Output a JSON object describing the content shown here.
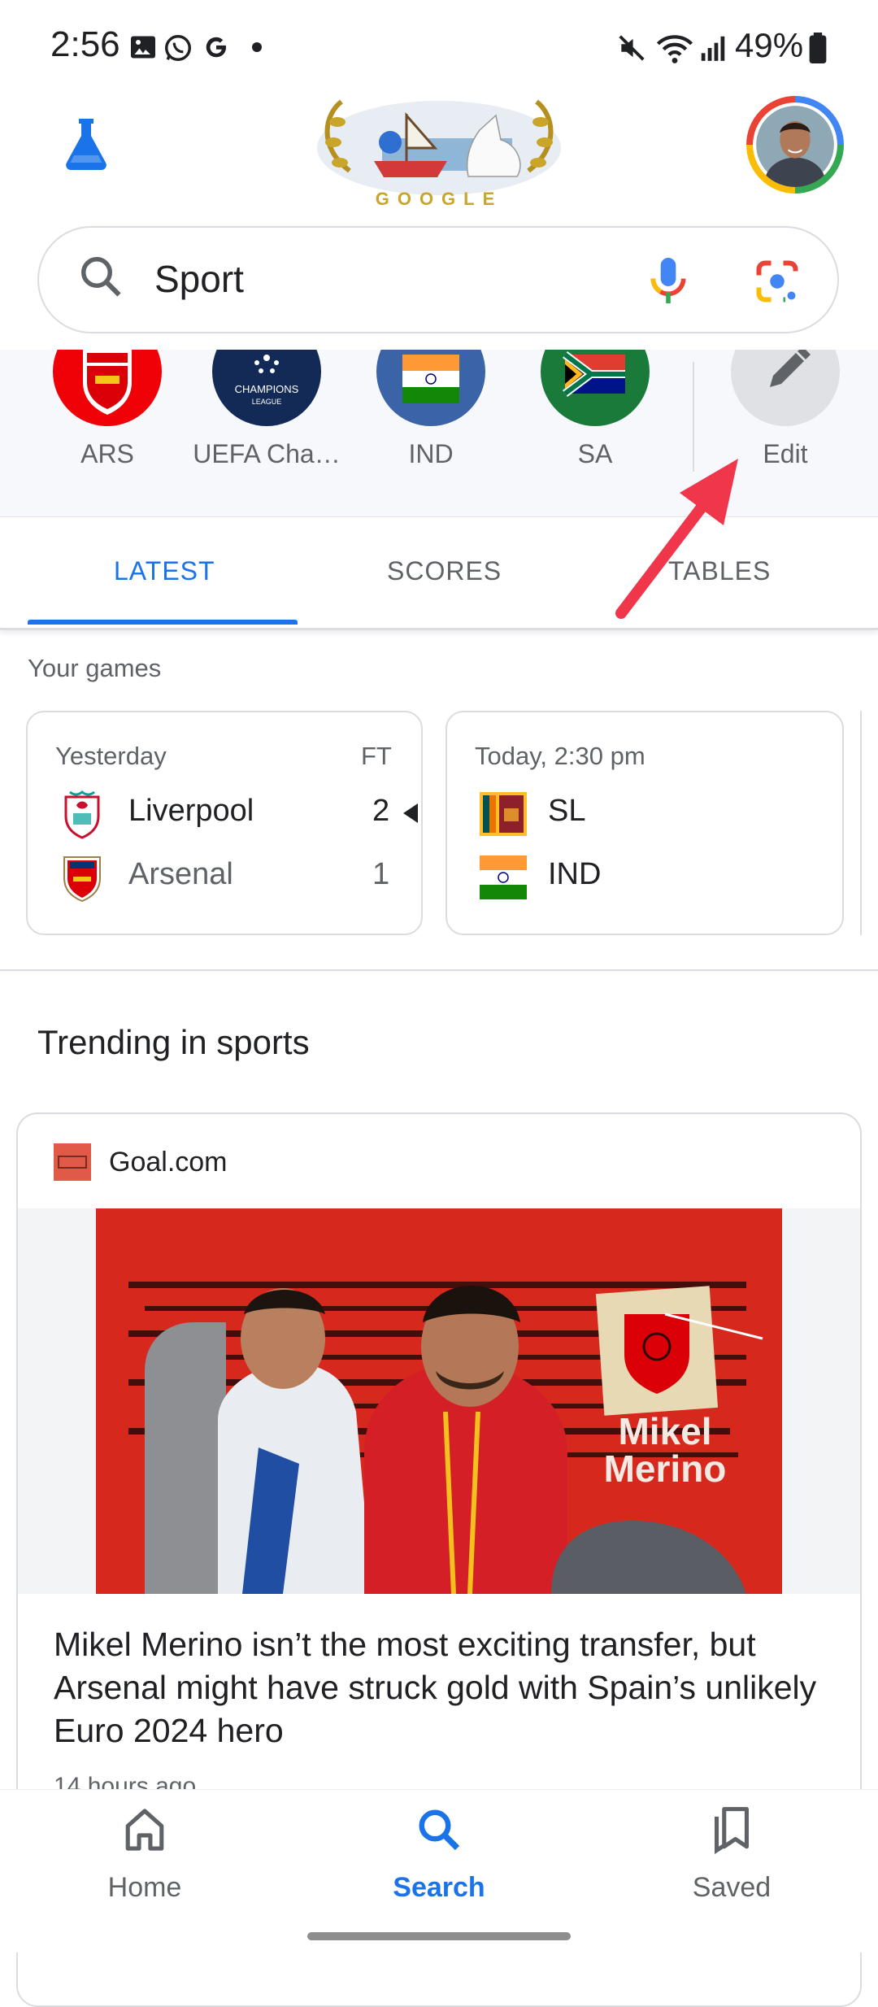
{
  "status_bar": {
    "time": "2:56",
    "battery": "49%"
  },
  "search": {
    "query": "Sport"
  },
  "doodle": {
    "text": "GOOGLE"
  },
  "shortcuts": [
    {
      "label": "ARS"
    },
    {
      "label": "UEFA Champions League",
      "display": "UEFA Cha…"
    },
    {
      "label": "IND"
    },
    {
      "label": "SA"
    },
    {
      "label": "Edit"
    }
  ],
  "tabs": [
    {
      "label": "LATEST",
      "selected": true
    },
    {
      "label": "SCORES",
      "selected": false
    },
    {
      "label": "TABLES",
      "selected": false
    }
  ],
  "your_games": {
    "heading": "Your games",
    "cards": [
      {
        "when": "Yesterday",
        "status": "FT",
        "teams": [
          {
            "name": "Liverpool",
            "score": "2",
            "winner": true
          },
          {
            "name": "Arsenal",
            "score": "1",
            "winner": false
          }
        ]
      },
      {
        "when": "Today, 2:30 pm",
        "status": "",
        "teams": [
          {
            "name": "SL",
            "score": ""
          },
          {
            "name": "IND",
            "score": ""
          }
        ]
      }
    ]
  },
  "trending": {
    "heading": "Trending in sports",
    "article": {
      "source": "Goal.com",
      "image_text": [
        "Mikel",
        "Merino"
      ],
      "headline": "Mikel Merino isn’t the most exciting transfer, but Arsenal might have struck gold with Spain’s unlikely Euro 2024 hero",
      "timestamp": "14 hours ago"
    }
  },
  "bottom_nav": [
    {
      "label": "Home",
      "icon": "home-icon",
      "active": false
    },
    {
      "label": "Search",
      "icon": "search-icon",
      "active": true
    },
    {
      "label": "Saved",
      "icon": "bookmarks-icon",
      "active": false
    }
  ],
  "colors": {
    "accent": "#1a73e8",
    "annotation_arrow": "#f0364a",
    "arsenal_red": "#ef0107",
    "goal_logo": "#e05a47"
  }
}
